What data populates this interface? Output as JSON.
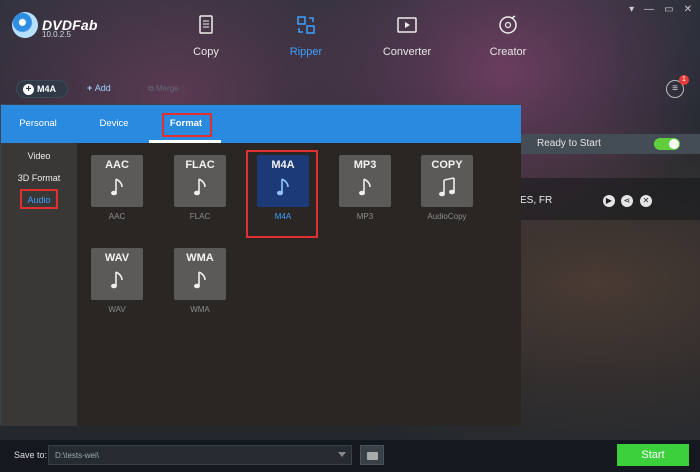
{
  "app": {
    "name": "DVDFab",
    "version": "10.0.2.5"
  },
  "window_controls": [
    "▾",
    "—",
    "▭",
    "✕"
  ],
  "nav": [
    {
      "label": "Copy",
      "icon": "copy-icon"
    },
    {
      "label": "Ripper",
      "icon": "ripper-icon",
      "active": true
    },
    {
      "label": "Converter",
      "icon": "converter-icon"
    },
    {
      "label": "Creator",
      "icon": "creator-icon"
    }
  ],
  "toolbar": {
    "mode_label": "M4A",
    "add_label": "Add",
    "merge_label": "Merge",
    "notification_count": "1"
  },
  "task": {
    "status": "Ready to Start",
    "track_text": "ES, FR"
  },
  "popup": {
    "tabs": [
      {
        "label": "Personal"
      },
      {
        "label": "Device"
      },
      {
        "label": "Format",
        "active": true
      }
    ],
    "categories": [
      {
        "label": "Video"
      },
      {
        "label": "3D Format"
      },
      {
        "label": "Audio",
        "selected": true
      }
    ],
    "formats": [
      {
        "tile": "AAC",
        "caption": "AAC"
      },
      {
        "tile": "FLAC",
        "caption": "FLAC"
      },
      {
        "tile": "M4A",
        "caption": "M4A",
        "selected": true
      },
      {
        "tile": "MP3",
        "caption": "MP3"
      },
      {
        "tile": "COPY",
        "caption": "AudioCopy"
      },
      {
        "tile": "WAV",
        "caption": "WAV"
      },
      {
        "tile": "WMA",
        "caption": "WMA"
      }
    ]
  },
  "bottom": {
    "save_label": "Save to:",
    "path": "D:\\tests-wei\\",
    "start_label": "Start"
  },
  "colors": {
    "accent": "#2a8ae0",
    "selected_text": "#3da0ff",
    "start": "#3cd13c",
    "highlight": "#e23030"
  }
}
